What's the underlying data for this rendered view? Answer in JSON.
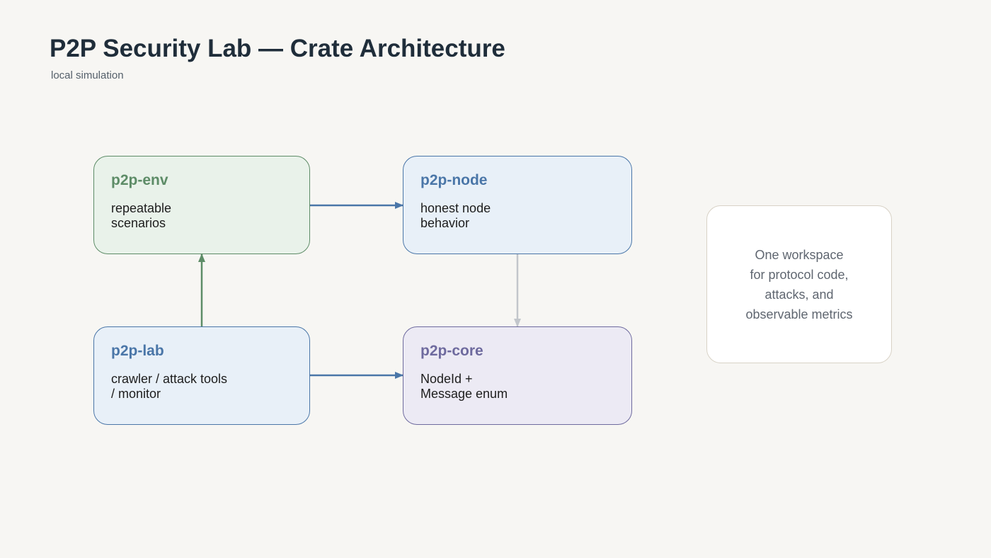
{
  "header": {
    "title": "P2P Security Lab — Crate Architecture",
    "subtitle": "local simulation"
  },
  "crates": {
    "env": {
      "name": "p2p-env",
      "description": "repeatable\nscenarios"
    },
    "node": {
      "name": "p2p-node",
      "description": "honest node\nbehavior"
    },
    "lab": {
      "name": "p2p-lab",
      "description": "crawler / attack tools\n/ monitor"
    },
    "core": {
      "name": "p2p-core",
      "description": "NodeId +\nMessage enum"
    }
  },
  "note": {
    "text": "One workspace\nfor protocol code,\nattacks, and\nobservable metrics"
  },
  "colors": {
    "background": "#f7f6f3",
    "green": "#5d8c67",
    "blue": "#4a76a8",
    "purple": "#6e6a9e",
    "gray_arrow": "#c2c6cb"
  }
}
